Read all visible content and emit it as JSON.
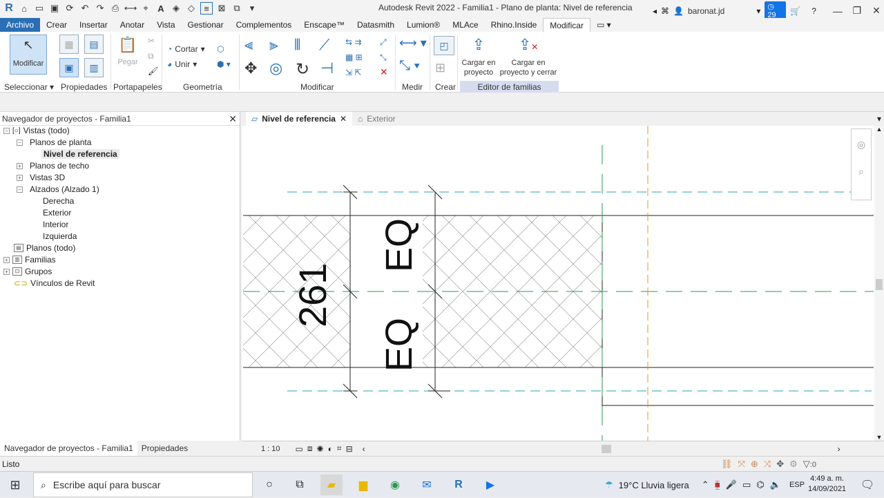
{
  "titlebar": {
    "app_title": "Autodesk Revit 2022 - Familia1 - Plano de planta: Nivel de referencia",
    "user": "baronat.jd",
    "notifications": "29"
  },
  "ribbon": {
    "tabs": [
      "Archivo",
      "Crear",
      "Insertar",
      "Anotar",
      "Vista",
      "Gestionar",
      "Complementos",
      "Enscape™",
      "Datasmith",
      "Lumion®",
      "MLAce",
      "Rhino.Inside",
      "Modificar"
    ],
    "modificar_label": "Modificar",
    "pegar_label": "Pegar",
    "cortar_label": "Cortar",
    "unir_label": "Unir",
    "cargar_proyecto": "Cargar en proyecto",
    "cargar_cerrar": "Cargar en proyecto y cerrar",
    "panels": {
      "seleccionar": "Seleccionar",
      "propiedades": "Propiedades",
      "portapapeles": "Portapapeles",
      "geometria": "Geometría",
      "modificar": "Modificar",
      "medir": "Medir",
      "crear": "Crear",
      "editor": "Editor de familias"
    }
  },
  "browser": {
    "title": "Navegador de proyectos - Familia1",
    "tree": {
      "vistas": "Vistas (todo)",
      "planos_planta": "Planos de planta",
      "nivel_ref": "Nivel de referencia",
      "planos_techo": "Planos de techo",
      "vistas3d": "Vistas 3D",
      "alzados": "Alzados (Alzado 1)",
      "derecha": "Derecha",
      "exterior": "Exterior",
      "interior": "Interior",
      "izquierda": "Izquierda",
      "planos_todo": "Planos (todo)",
      "familias": "Familias",
      "grupos": "Grupos",
      "vinculos": "Vínculos de Revit"
    },
    "footer_tabs": [
      "Navegador de proyectos - Familia1",
      "Propiedades"
    ]
  },
  "view_tabs": {
    "active": "Nivel de referencia",
    "other": "Exterior"
  },
  "drawing": {
    "dim_value": "261",
    "eq_top": "EQ",
    "eq_top2": "EQ",
    "eq_bottom": "EQ"
  },
  "viewbar": {
    "scale": "1 : 10"
  },
  "status": {
    "text": "Listo",
    "filter_count": ":0"
  },
  "taskbar": {
    "search_placeholder": "Escribe aquí para buscar",
    "weather": "19°C  Lluvia ligera",
    "lang": "ESP",
    "time": "4:49 a. m.",
    "date": "14/09/2021"
  }
}
